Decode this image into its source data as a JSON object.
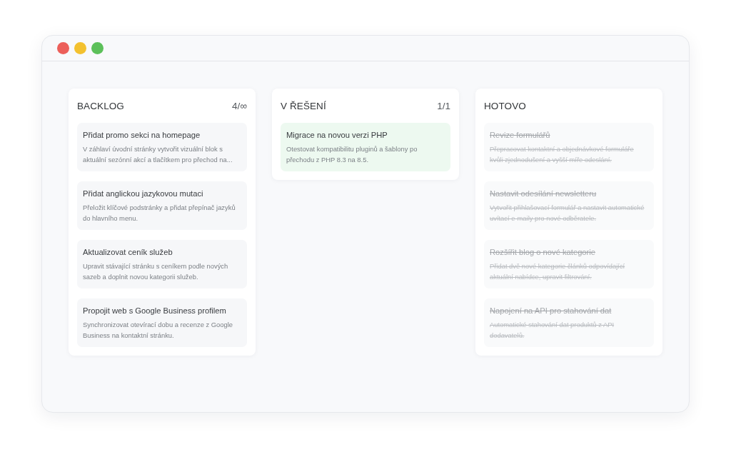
{
  "window": {
    "controls": [
      {
        "color": "#ec5f5a"
      },
      {
        "color": "#f3c12f"
      },
      {
        "color": "#5cc05a"
      }
    ]
  },
  "columns": [
    {
      "title": "BACKLOG",
      "count": "4/∞",
      "cards": [
        {
          "kind": "open",
          "title": "Přidat promo sekci na homepage",
          "description": "V záhlaví úvodní stránky vytvořit vizuální blok s aktuální sezónní akcí a tlačítkem pro přechod na..."
        },
        {
          "kind": "open",
          "title": "Přidat anglickou jazykovou mutaci",
          "description": "Přeložit klíčové podstránky a přidat přepínač jazyků do hlavního menu."
        },
        {
          "kind": "open",
          "title": "Aktualizovat ceník služeb",
          "description": "Upravit stávající stránku s ceníkem podle nových sazeb a doplnit novou kategorii služeb."
        },
        {
          "kind": "open",
          "title": "Propojit web s Google Business profilem",
          "description": "Synchronizovat otevírací dobu a recenze z Google Business na kontaktní stránku."
        }
      ]
    },
    {
      "title": "V ŘEŠENÍ",
      "count": "1/1",
      "cards": [
        {
          "kind": "in_progress",
          "title": "Migrace na novou verzi PHP",
          "description": "Otestovat kompatibilitu pluginů a šablony po přechodu z PHP 8.3 na 8.5."
        }
      ]
    },
    {
      "title": "HOTOVO",
      "cards": [
        {
          "kind": "done",
          "title": "Revize formulářů",
          "description": "Přepracovat kontaktní a objednávkové formuláře kvůli zjednodušení a vyšší míře odeslání."
        },
        {
          "kind": "done",
          "title": "Nastavit odesílání newsletteru",
          "description": "Vytvořit přihlašovací formulář a nastavit automatické uvítací e-maily pro nové odběratele."
        },
        {
          "kind": "done",
          "title": "Rozšířit blog o nové kategorie",
          "description": "Přidat dvě nové kategorie článků odpovídající aktuální nabídce, upravit filtrování."
        },
        {
          "kind": "done",
          "title": "Napojení na API pro stahování dat",
          "description": "Automatické stahování dat produktů z API dodavatelů."
        }
      ]
    }
  ]
}
